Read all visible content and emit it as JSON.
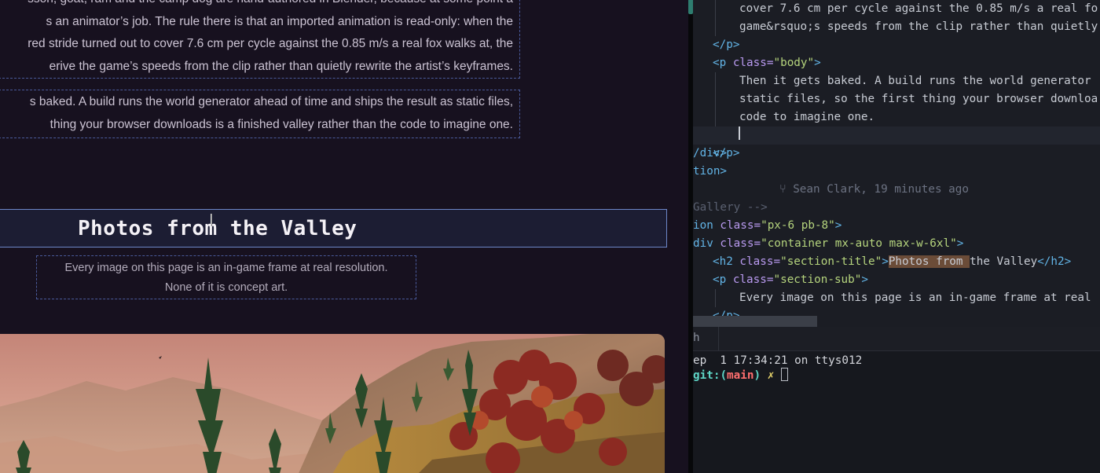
{
  "preview": {
    "para1": [
      "sson, goat, ram and the camp dog are hand-authored in Blender, because at some point a",
      "s an animator’s job. The rule there is that an imported animation is read-only: when the",
      "red stride turned out to cover 7.6 cm per cycle against the 0.85 m/s a real fox walks at, the",
      "erive the game’s speeds from the clip rather than quietly rewrite the artist’s keyframes."
    ],
    "para2": [
      "s baked. A build runs the world generator ahead of time and ships the result as static files,",
      "thing your browser downloads is a finished valley rather than the code to imagine one."
    ],
    "section_title": "Photos from the Valley",
    "section_sub": [
      "Every image on this page is an in-game frame at real resolution.",
      "None of it is concept art."
    ]
  },
  "editor": {
    "l1": "cover 7.6 cm per cycle against the 0.85 m/s a real fo",
    "l2": "game&rsquo;s speeds from the clip rather than quietly",
    "l3_close": "</p>",
    "l4_open": "<p",
    "l4_attr": " class=",
    "l4_val": "\"body\"",
    "l4_end": ">",
    "l5": "Then it gets baked. A build runs the world generator",
    "l6": "static files, so the first thing your browser downloa",
    "l7": "code to imagine one.",
    "l8_close": "</p>",
    "blame": "Sean Clark, 19 minutes ago",
    "l9": "/div>",
    "l10": "tion>",
    "l11": "Gallery -->",
    "l12_tag": "ion",
    "l12_attr": " class=",
    "l12_val": "\"px-6 pb-8\"",
    "l12_end": ">",
    "l13_tag": "div",
    "l13_attr": " class=",
    "l13_val": "\"container mx-auto max-w-6xl\"",
    "l13_end": ">",
    "l14_open": "<h2",
    "l14_attr": " class=",
    "l14_val": "\"section-title\"",
    "l14_gt": ">",
    "l14_sel": "Photos from ",
    "l14_rest": "the Valley",
    "l14_close": "</h2>",
    "l15_open": "<p",
    "l15_attr": " class=",
    "l15_val": "\"section-sub\"",
    "l15_end": ">",
    "l16": "Every image on this page is an in-game frame at real",
    "l17_close": "</p>"
  },
  "terminal": {
    "tab_label": "h",
    "login_line": "ep  1 17:34:21 on ttys012",
    "prompt_git": "git:",
    "prompt_paren_open": "(",
    "prompt_branch": "main",
    "prompt_paren_close": ")",
    "prompt_mark": "✗"
  },
  "colors": {
    "preview_bg": "#17111f",
    "editor_bg": "#1b1d24",
    "tag": "#62b4e6",
    "attr": "#b99af0",
    "string": "#b5d47d",
    "selection": "#6b4c38",
    "prompt": "#5ed6c6",
    "branch": "#ff6f6f"
  }
}
